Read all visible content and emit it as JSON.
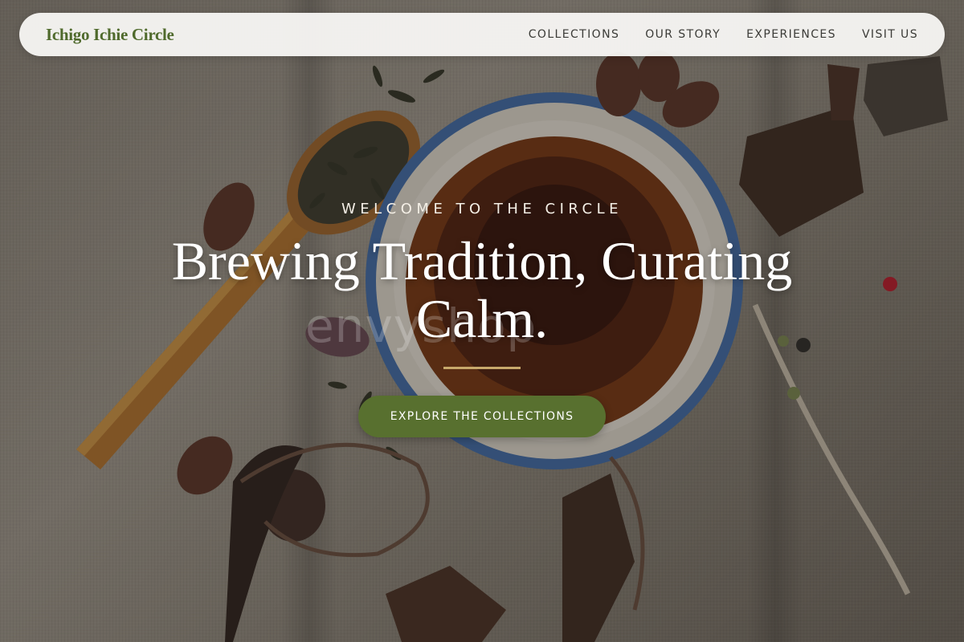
{
  "nav": {
    "brand": "Ichigo Ichie Circle",
    "links": [
      {
        "label": "COLLECTIONS"
      },
      {
        "label": "OUR STORY"
      },
      {
        "label": "EXPERIENCES"
      },
      {
        "label": "VISIT US"
      }
    ]
  },
  "hero": {
    "eyebrow": "WELCOME TO THE CIRCLE",
    "headline": "Brewing Tradition, Curating Calm.",
    "cta_label": "EXPLORE THE COLLECTIONS",
    "watermark": "envyshop",
    "image": "tea-table-photo"
  },
  "colors": {
    "brand_green": "#58702f",
    "brand_text_green": "#4f6a2c",
    "accent_gold": "#c8a96b",
    "nav_bg": "#f8f7f4"
  }
}
